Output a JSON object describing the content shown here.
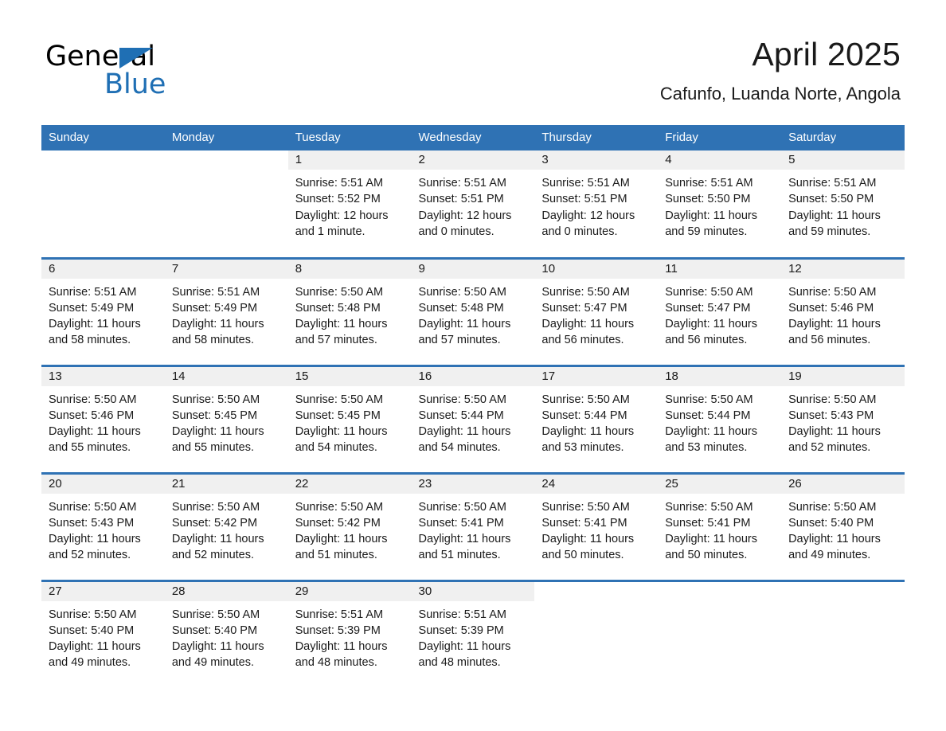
{
  "brand": {
    "name_part1": "General",
    "name_part2": "Blue",
    "accent_color": "#1f6fb4"
  },
  "header": {
    "month_title": "April 2025",
    "location": "Cafunfo, Luanda Norte, Angola"
  },
  "calendar": {
    "header_bg": "#2f72b4",
    "daynum_bg": "#f0f0f0",
    "weekday_headers": [
      "Sunday",
      "Monday",
      "Tuesday",
      "Wednesday",
      "Thursday",
      "Friday",
      "Saturday"
    ],
    "weeks": [
      [
        {
          "day": "",
          "blank": true,
          "lines": []
        },
        {
          "day": "",
          "blank": true,
          "lines": []
        },
        {
          "day": "1",
          "lines": [
            "Sunrise: 5:51 AM",
            "Sunset: 5:52 PM",
            "Daylight: 12 hours",
            "and 1 minute."
          ]
        },
        {
          "day": "2",
          "lines": [
            "Sunrise: 5:51 AM",
            "Sunset: 5:51 PM",
            "Daylight: 12 hours",
            "and 0 minutes."
          ]
        },
        {
          "day": "3",
          "lines": [
            "Sunrise: 5:51 AM",
            "Sunset: 5:51 PM",
            "Daylight: 12 hours",
            "and 0 minutes."
          ]
        },
        {
          "day": "4",
          "lines": [
            "Sunrise: 5:51 AM",
            "Sunset: 5:50 PM",
            "Daylight: 11 hours",
            "and 59 minutes."
          ]
        },
        {
          "day": "5",
          "lines": [
            "Sunrise: 5:51 AM",
            "Sunset: 5:50 PM",
            "Daylight: 11 hours",
            "and 59 minutes."
          ]
        }
      ],
      [
        {
          "day": "6",
          "lines": [
            "Sunrise: 5:51 AM",
            "Sunset: 5:49 PM",
            "Daylight: 11 hours",
            "and 58 minutes."
          ]
        },
        {
          "day": "7",
          "lines": [
            "Sunrise: 5:51 AM",
            "Sunset: 5:49 PM",
            "Daylight: 11 hours",
            "and 58 minutes."
          ]
        },
        {
          "day": "8",
          "lines": [
            "Sunrise: 5:50 AM",
            "Sunset: 5:48 PM",
            "Daylight: 11 hours",
            "and 57 minutes."
          ]
        },
        {
          "day": "9",
          "lines": [
            "Sunrise: 5:50 AM",
            "Sunset: 5:48 PM",
            "Daylight: 11 hours",
            "and 57 minutes."
          ]
        },
        {
          "day": "10",
          "lines": [
            "Sunrise: 5:50 AM",
            "Sunset: 5:47 PM",
            "Daylight: 11 hours",
            "and 56 minutes."
          ]
        },
        {
          "day": "11",
          "lines": [
            "Sunrise: 5:50 AM",
            "Sunset: 5:47 PM",
            "Daylight: 11 hours",
            "and 56 minutes."
          ]
        },
        {
          "day": "12",
          "lines": [
            "Sunrise: 5:50 AM",
            "Sunset: 5:46 PM",
            "Daylight: 11 hours",
            "and 56 minutes."
          ]
        }
      ],
      [
        {
          "day": "13",
          "lines": [
            "Sunrise: 5:50 AM",
            "Sunset: 5:46 PM",
            "Daylight: 11 hours",
            "and 55 minutes."
          ]
        },
        {
          "day": "14",
          "lines": [
            "Sunrise: 5:50 AM",
            "Sunset: 5:45 PM",
            "Daylight: 11 hours",
            "and 55 minutes."
          ]
        },
        {
          "day": "15",
          "lines": [
            "Sunrise: 5:50 AM",
            "Sunset: 5:45 PM",
            "Daylight: 11 hours",
            "and 54 minutes."
          ]
        },
        {
          "day": "16",
          "lines": [
            "Sunrise: 5:50 AM",
            "Sunset: 5:44 PM",
            "Daylight: 11 hours",
            "and 54 minutes."
          ]
        },
        {
          "day": "17",
          "lines": [
            "Sunrise: 5:50 AM",
            "Sunset: 5:44 PM",
            "Daylight: 11 hours",
            "and 53 minutes."
          ]
        },
        {
          "day": "18",
          "lines": [
            "Sunrise: 5:50 AM",
            "Sunset: 5:44 PM",
            "Daylight: 11 hours",
            "and 53 minutes."
          ]
        },
        {
          "day": "19",
          "lines": [
            "Sunrise: 5:50 AM",
            "Sunset: 5:43 PM",
            "Daylight: 11 hours",
            "and 52 minutes."
          ]
        }
      ],
      [
        {
          "day": "20",
          "lines": [
            "Sunrise: 5:50 AM",
            "Sunset: 5:43 PM",
            "Daylight: 11 hours",
            "and 52 minutes."
          ]
        },
        {
          "day": "21",
          "lines": [
            "Sunrise: 5:50 AM",
            "Sunset: 5:42 PM",
            "Daylight: 11 hours",
            "and 52 minutes."
          ]
        },
        {
          "day": "22",
          "lines": [
            "Sunrise: 5:50 AM",
            "Sunset: 5:42 PM",
            "Daylight: 11 hours",
            "and 51 minutes."
          ]
        },
        {
          "day": "23",
          "lines": [
            "Sunrise: 5:50 AM",
            "Sunset: 5:41 PM",
            "Daylight: 11 hours",
            "and 51 minutes."
          ]
        },
        {
          "day": "24",
          "lines": [
            "Sunrise: 5:50 AM",
            "Sunset: 5:41 PM",
            "Daylight: 11 hours",
            "and 50 minutes."
          ]
        },
        {
          "day": "25",
          "lines": [
            "Sunrise: 5:50 AM",
            "Sunset: 5:41 PM",
            "Daylight: 11 hours",
            "and 50 minutes."
          ]
        },
        {
          "day": "26",
          "lines": [
            "Sunrise: 5:50 AM",
            "Sunset: 5:40 PM",
            "Daylight: 11 hours",
            "and 49 minutes."
          ]
        }
      ],
      [
        {
          "day": "27",
          "lines": [
            "Sunrise: 5:50 AM",
            "Sunset: 5:40 PM",
            "Daylight: 11 hours",
            "and 49 minutes."
          ]
        },
        {
          "day": "28",
          "lines": [
            "Sunrise: 5:50 AM",
            "Sunset: 5:40 PM",
            "Daylight: 11 hours",
            "and 49 minutes."
          ]
        },
        {
          "day": "29",
          "lines": [
            "Sunrise: 5:51 AM",
            "Sunset: 5:39 PM",
            "Daylight: 11 hours",
            "and 48 minutes."
          ]
        },
        {
          "day": "30",
          "lines": [
            "Sunrise: 5:51 AM",
            "Sunset: 5:39 PM",
            "Daylight: 11 hours",
            "and 48 minutes."
          ]
        },
        {
          "day": "",
          "blank": true,
          "lines": []
        },
        {
          "day": "",
          "blank": true,
          "lines": []
        },
        {
          "day": "",
          "blank": true,
          "lines": []
        }
      ]
    ]
  }
}
